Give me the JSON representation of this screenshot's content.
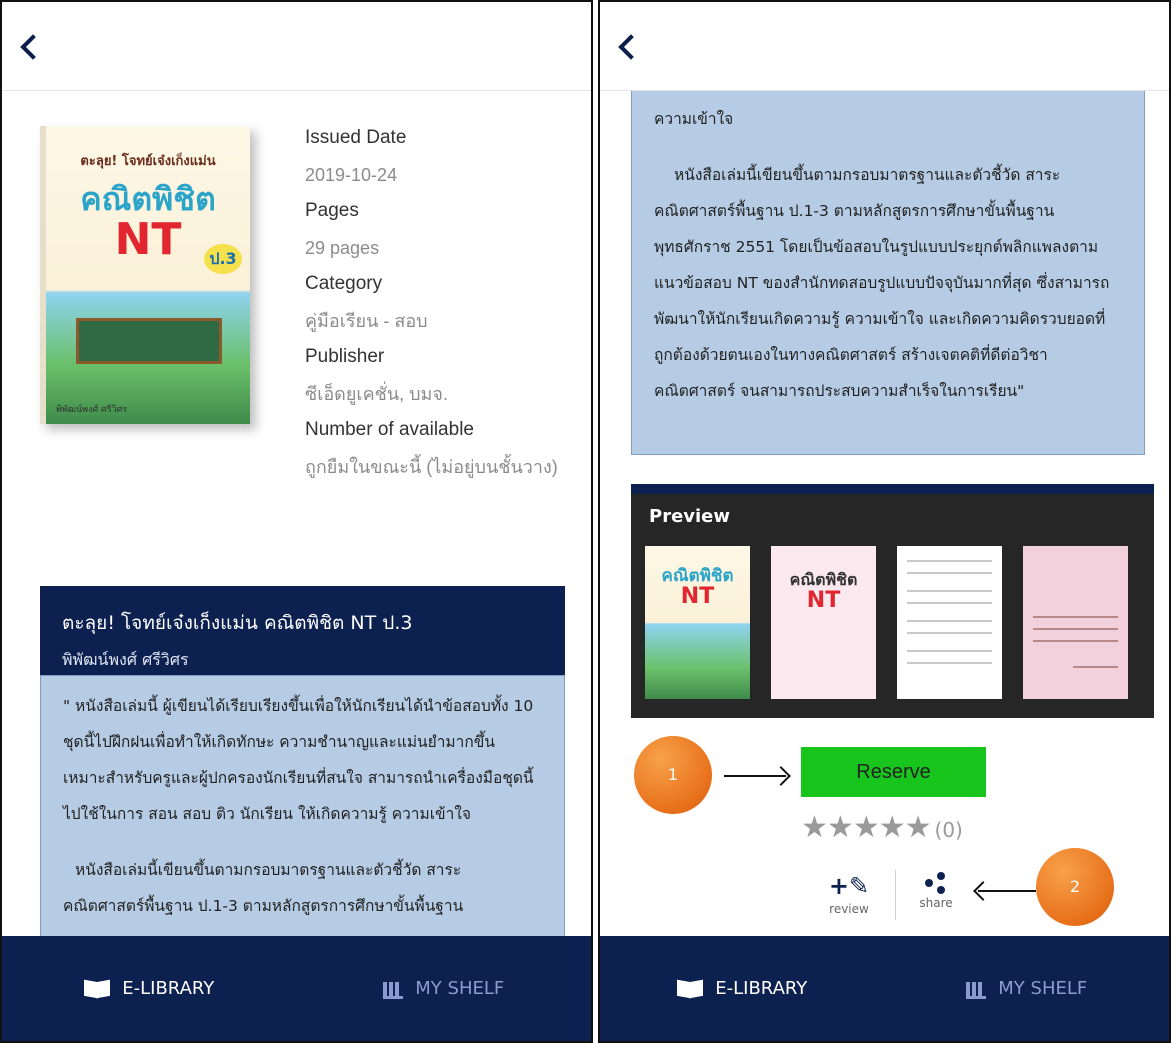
{
  "left": {
    "meta": [
      {
        "label": "Issued Date",
        "value": "2019-10-24"
      },
      {
        "label": "Pages",
        "value": "29 pages"
      },
      {
        "label": "Category",
        "value": "คู่มือเรียน - สอบ"
      },
      {
        "label": "Publisher",
        "value": "ซีเอ็ดยูเคชั่น, บมจ."
      },
      {
        "label": "Number of available",
        "value": "ถูกยืมในขณะนี้ (ไม่อยู่บนชั้นวาง)"
      }
    ],
    "cover": {
      "line1": "ตะลุย! โจทย์เจ๋งเก็งแม่น",
      "line2": "คณิตพิชิต",
      "line3": "NT",
      "grade": "ป.3",
      "author": "พิพัฒน์พงศ์ ศรีวิศร"
    },
    "book": {
      "title": "ตะลุย! โจทย์เจ๋งเก็งแม่น คณิตพิชิต NT ป.3",
      "author": "พิพัฒน์พงศ์ ศรีวิศร"
    },
    "description": {
      "p1": "\" หนังสือเล่มนี้ ผู้เขียนได้เรียบเรียงขึ้นเพื่อให้นักเรียนได้นำข้อสอบทั้ง 10 ชุดนี้ไปฝึกฝนเพื่อทำให้เกิดทักษะ ความชำนาญและแม่นยำมากขึ้น เหมาะสำหรับครูและผู้ปกครองนักเรียนที่สนใจ สามารถนำเครื่องมือชุดนี้ไปใช้ในการ สอน สอบ ติว นักเรียน ให้เกิดความรู้ ความเข้าใจ",
      "p2": "หนังสือเล่มนี้เขียนขึ้นตามกรอบมาตรฐานและตัวชี้วัด สาระคณิตศาสตร์พื้นฐาน ป.1-3 ตามหลักสูตรการศึกษาขั้นพื้นฐาน"
    }
  },
  "right": {
    "description": {
      "p0": "ความเข้าใจ",
      "p1": "หนังสือเล่มนี้เขียนขึ้นตามกรอบมาตรฐานและตัวชี้วัด สาระคณิตศาสตร์พื้นฐาน ป.1-3 ตามหลักสูตรการศึกษาขั้นพื้นฐาน พุทธศักราช 2551 โดยเป็นข้อสอบในรูปแบบประยุกต์พลิกแพลงตามแนวข้อสอบ NT ของสำนักทดสอบรูปแบบปัจจุบันมากที่สุด ซึ่งสามารถพัฒนาให้นักเรียนเกิดความรู้ ความเข้าใจ และเกิดความคิดรวบยอดที่ถูกต้องด้วยตนเองในทางคณิตศาสตร์ สร้างเจตคติที่ดีต่อวิชาคณิตศาสตร์ จนสามารถประสบความสำเร็จในการเรียน\""
    },
    "preview": {
      "label": "Preview",
      "thumb1_title": "คณิตพิชิต",
      "thumb1_nt": "NT",
      "thumb2_title": "คณิตพิชิต",
      "thumb2_nt": "NT"
    },
    "reserve_label": "Reserve",
    "rating": {
      "stars": 5,
      "filled": 0,
      "count_text": "(0)"
    },
    "actions": {
      "review": "review",
      "share": "share"
    },
    "callouts": {
      "one": "1",
      "two": "2"
    }
  },
  "bottom_nav": {
    "elibrary": "E-LIBRARY",
    "myshelf": "MY SHELF"
  },
  "colors": {
    "navy": "#0d2150",
    "desc_bg": "#b6cce5",
    "reserve": "#17c51c",
    "callout": "#e8701a"
  }
}
